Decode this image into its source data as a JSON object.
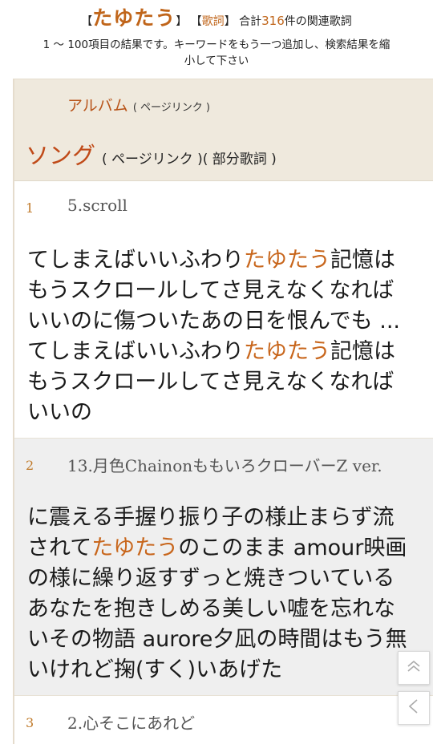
{
  "header": {
    "bracket_open": "【",
    "keyword": "たゆたう",
    "bracket_close": "】",
    "cat_open": "【",
    "category": "歌詞",
    "cat_close": "】",
    "total_prefix": "合計",
    "total_count": "316",
    "total_suffix": "件の関連歌詞",
    "subtitle_line1": "1 ～ 100項目の結果です。キーワードをもう一つ追加し、検索結果を縮",
    "subtitle_line2": "小して下さい"
  },
  "panel": {
    "album_label": "アルバム",
    "album_link": "( ページリンク )",
    "song_label": "ソング",
    "song_link": "( ページリンク )( 部分歌詞 )"
  },
  "results": [
    {
      "index": "1",
      "title": "5.scroll",
      "lines": [
        [
          "てしまえばいいふわり",
          "たゆたう",
          "記憶は"
        ],
        [
          "もうスクロールしてさ見えなくなれば"
        ],
        [
          "いいのに傷ついたあの日を恨んでも ..."
        ],
        [
          "てしまえばいいふわり",
          "たゆたう",
          "記憶は"
        ],
        [
          "もうスクロールしてさ見えなくなれば"
        ],
        [
          "いいの"
        ]
      ]
    },
    {
      "index": "2",
      "title": "13.月色ChainonももいろクローバーZ ver.",
      "lines": [
        [
          "に震える手握り振り子の様止まらず流"
        ],
        [
          "されて",
          "たゆたう",
          "のこのまま amour映画"
        ],
        [
          "の様に繰り返すずっと焼きついている"
        ],
        [
          "あなたを抱きしめる美しい嘘を忘れな"
        ],
        [
          "いその物語 aurore夕凪の時間はもう無"
        ],
        [
          "いけれど掬(すく)いあげた"
        ]
      ]
    },
    {
      "index": "3",
      "title": "2.心そこにあれど"
    }
  ],
  "icons": {
    "scroll_top": "double-chevron-up-icon",
    "back": "chevron-left-icon"
  }
}
